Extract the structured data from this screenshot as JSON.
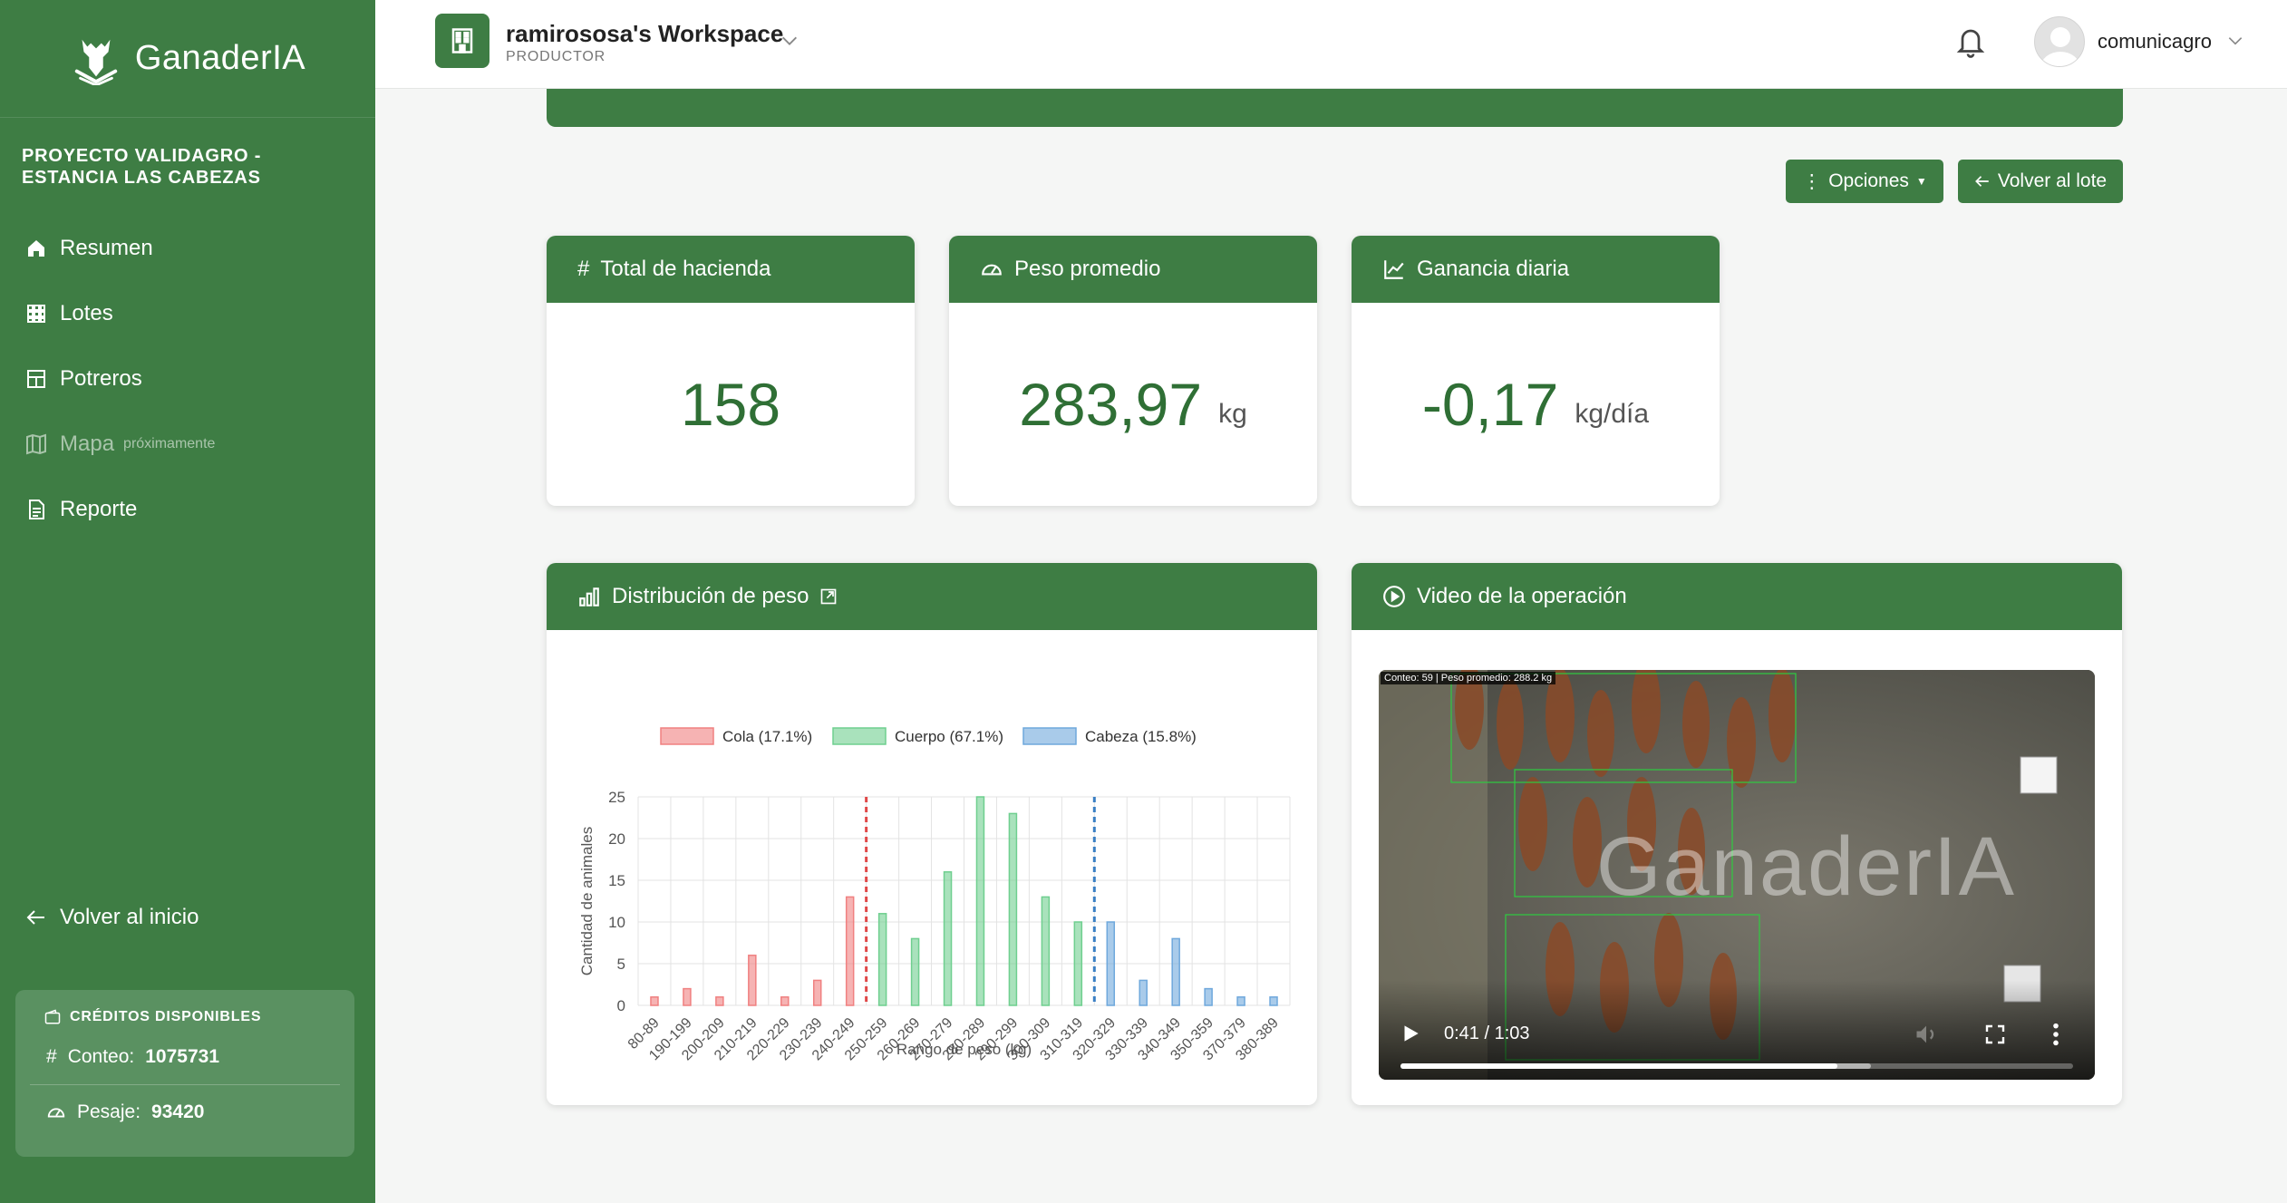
{
  "brand": {
    "name": "GanaderIA"
  },
  "sidebar": {
    "project": "PROYECTO VALIDAGRO - ESTANCIA LAS CABEZAS",
    "items": [
      {
        "label": "Resumen",
        "icon": "home-icon"
      },
      {
        "label": "Lotes",
        "icon": "grid-icon"
      },
      {
        "label": "Potreros",
        "icon": "layout-icon"
      },
      {
        "label": "Mapa",
        "icon": "map-icon",
        "badge": "próximamente",
        "disabled": true
      },
      {
        "label": "Reporte",
        "icon": "file-icon"
      }
    ],
    "back_label": "Volver al inicio",
    "credits": {
      "title": "CRÉDITOS DISPONIBLES",
      "conteo_label": "Conteo:",
      "conteo_value": "1075731",
      "pesaje_label": "Pesaje:",
      "pesaje_value": "93420"
    }
  },
  "topbar": {
    "workspace_name": "ramirososa's Workspace",
    "workspace_role": "PRODUCTOR",
    "user_name": "comunicagro"
  },
  "actions": {
    "options_label": "Opciones",
    "back_label": "Volver al lote"
  },
  "stats": {
    "total": {
      "title": "Total de hacienda",
      "value": "158",
      "unit": ""
    },
    "weight": {
      "title": "Peso promedio",
      "value": "283,97",
      "unit": "kg"
    },
    "gain": {
      "title": "Ganancia diaria",
      "value": "-0,17",
      "unit": "kg/día"
    }
  },
  "distribution": {
    "title": "Distribución de peso"
  },
  "video_card": {
    "title": "Video de la operación",
    "overlay_info": "Conteo: 59 | Peso promedio: 288.2 kg",
    "watermark": "GanaderIA",
    "time": "0:41 / 1:03",
    "progress": 0.65,
    "buffered": 0.7
  },
  "colors": {
    "primary": "#3e7d44",
    "cola": "#f08080",
    "cuerpo": "#6fcf8f",
    "cabeza": "#6fa8dc"
  },
  "chart_data": {
    "type": "bar",
    "xlabel": "Rango de peso (kg)",
    "ylabel": "Cantidad de animales",
    "ylim": [
      0,
      25
    ],
    "yticks": [
      0,
      5,
      10,
      15,
      20,
      25
    ],
    "categories": [
      "80-89",
      "190-199",
      "200-209",
      "210-219",
      "220-229",
      "230-239",
      "240-249",
      "250-259",
      "260-269",
      "270-279",
      "280-289",
      "290-299",
      "300-309",
      "310-319",
      "320-329",
      "330-339",
      "340-349",
      "350-359",
      "370-379",
      "380-389"
    ],
    "series": [
      {
        "name": "Cola (17.1%)",
        "color": "#f08080",
        "values": [
          1,
          2,
          1,
          6,
          1,
          3,
          13,
          null,
          null,
          null,
          null,
          null,
          null,
          null,
          null,
          null,
          null,
          null,
          null,
          null
        ]
      },
      {
        "name": "Cuerpo (67.1%)",
        "color": "#6fcf8f",
        "values": [
          null,
          null,
          null,
          null,
          null,
          null,
          null,
          11,
          8,
          16,
          25,
          23,
          13,
          10,
          null,
          null,
          null,
          null,
          null,
          null
        ]
      },
      {
        "name": "Cabeza (15.8%)",
        "color": "#6fa8dc",
        "values": [
          null,
          null,
          null,
          null,
          null,
          null,
          null,
          null,
          null,
          null,
          null,
          null,
          null,
          null,
          10,
          3,
          8,
          2,
          1,
          1
        ]
      }
    ],
    "thresholds": [
      {
        "between": [
          6,
          7
        ],
        "color": "#e04848"
      },
      {
        "between": [
          13,
          14
        ],
        "color": "#3a7fc4"
      }
    ],
    "grid": true,
    "legend": "top"
  }
}
